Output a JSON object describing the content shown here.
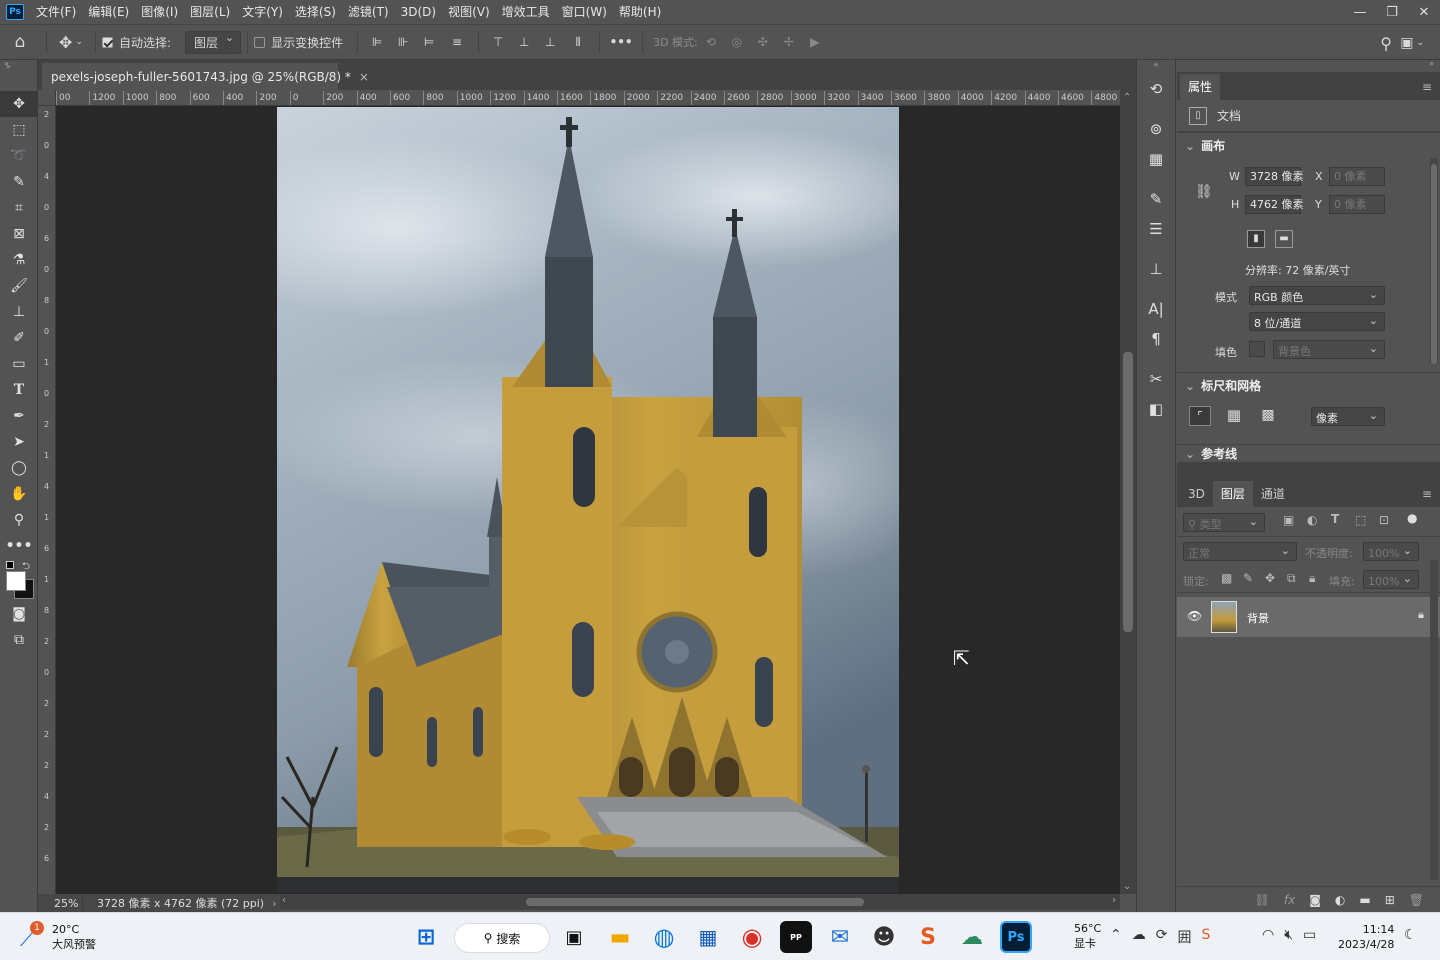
{
  "menubar": {
    "logo": "Ps",
    "items": [
      "文件(F)",
      "编辑(E)",
      "图像(I)",
      "图层(L)",
      "文字(Y)",
      "选择(S)",
      "滤镜(T)",
      "3D(D)",
      "视图(V)",
      "增效工具",
      "窗口(W)",
      "帮助(H)"
    ]
  },
  "optionsbar": {
    "auto_select_label": "自动选择:",
    "auto_select_target": "图层",
    "show_transform_label": "显示变换控件",
    "mode_3d_label": "3D 模式:",
    "more_label": "•••"
  },
  "document": {
    "tab_title": "pexels-joseph-fuller-5601743.jpg @ 25%(RGB/8) *",
    "zoom": "25%",
    "status_info": "3728 像素 x 4762 像素 (72 ppi)"
  },
  "ruler": {
    "h_ticks": [
      "00",
      "1200",
      "1000",
      "800",
      "600",
      "400",
      "200",
      "0",
      "200",
      "400",
      "600",
      "800",
      "1000",
      "1200",
      "1400",
      "1600",
      "1800",
      "2000",
      "2200",
      "2400",
      "2600",
      "2800",
      "3000",
      "3200",
      "3400",
      "3600",
      "3800",
      "4000",
      "4200",
      "4400",
      "4600",
      "4800",
      "5"
    ],
    "v_ticks": [
      "2",
      "0",
      "4",
      "0",
      "6",
      "0",
      "8",
      "0",
      "1",
      "0",
      "2",
      "1",
      "4",
      "1",
      "6",
      "1",
      "8",
      "2",
      "0",
      "2",
      "2",
      "2",
      "4",
      "2",
      "6"
    ]
  },
  "properties": {
    "tab": "属性",
    "doc_label": "文档",
    "canvas_section": "画布",
    "w_label": "W",
    "w_value": "3728 像素",
    "h_label": "H",
    "h_value": "4762 像素",
    "x_label": "X",
    "x_value": "0 像素",
    "y_label": "Y",
    "y_value": "0 像素",
    "resolution": "分辨率: 72 像素/英寸",
    "mode_label": "模式",
    "mode_value": "RGB 颜色",
    "bit_depth": "8 位/通道",
    "fill_label": "填色",
    "fill_value": "背景色",
    "rulers_section": "标尺和网格",
    "ruler_unit": "像素",
    "guides_section": "参考线"
  },
  "layers": {
    "tabs": [
      "3D",
      "图层",
      "通道"
    ],
    "active_tab": "图层",
    "filter_placeholder": "类型",
    "blend_mode": "正常",
    "opacity_label": "不透明度:",
    "opacity_value": "100%",
    "lock_label": "锁定:",
    "fill_label": "填充:",
    "fill_value": "100%",
    "items": [
      {
        "name": "背景",
        "locked": true,
        "visible": true
      }
    ]
  },
  "taskbar": {
    "weather_temp": "20°C",
    "weather_desc": "大风预警",
    "weather_badge": "1",
    "search_label": "搜索",
    "gpu_temp": "56°C",
    "gpu_label": "显卡",
    "time": "11:14",
    "date": "2023/4/28"
  },
  "colors": {
    "ui_bg": "#535353",
    "canvas_bg": "#282828",
    "ps_blue": "#31a8ff"
  }
}
